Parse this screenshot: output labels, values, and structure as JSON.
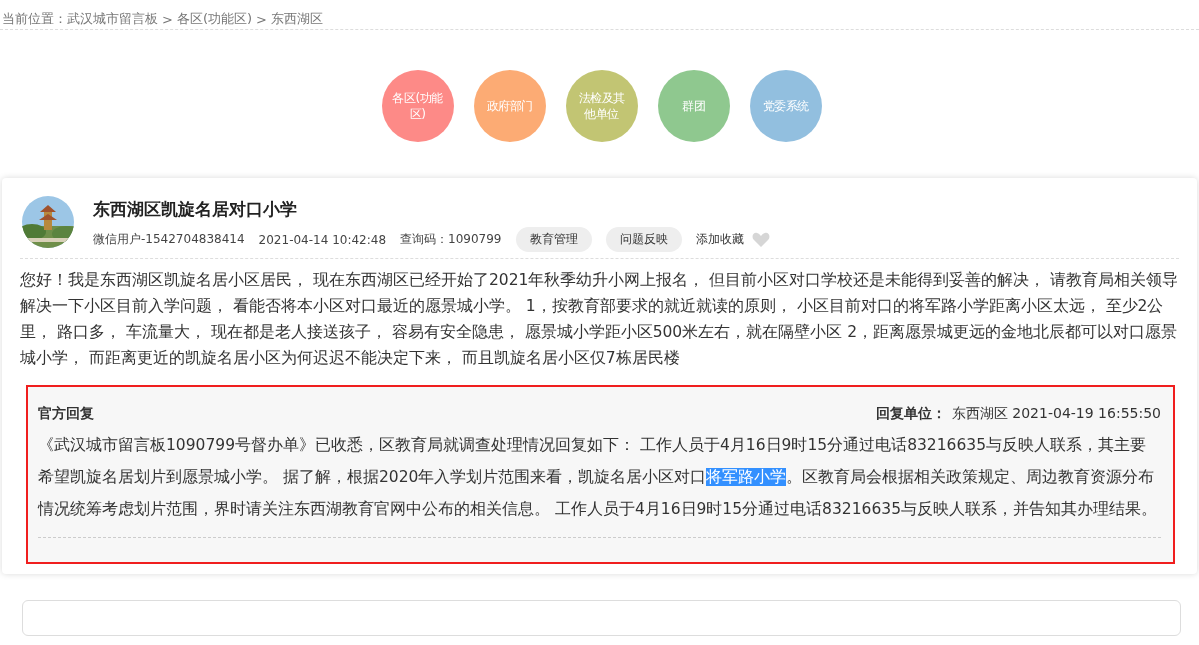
{
  "breadcrumb": {
    "label": "当前位置：",
    "items": [
      "武汉城市留言板",
      "各区(功能区)",
      "东西湖区"
    ],
    "separator": ">"
  },
  "categories": [
    {
      "label": "各区(功能区)",
      "color": "#fd8a87"
    },
    {
      "label": "政府部门",
      "color": "#fcab74"
    },
    {
      "label": "法检及其他单位",
      "color": "#c2c573"
    },
    {
      "label": "群团",
      "color": "#8fc88f"
    },
    {
      "label": "党委系统",
      "color": "#92bfdf"
    }
  ],
  "post": {
    "avatar": {
      "kind": "picture"
    },
    "title": "东西湖区凯旋名居对口小学",
    "author": "微信用户-1542704838414",
    "time": "2021-04-14 10:42:48",
    "query_code": "查询码：1090799",
    "tags": [
      "教育管理",
      "问题反映"
    ],
    "favorite": {
      "label": "添加收藏",
      "on": false
    },
    "body": "您好！我是东西湖区凯旋名居小区居民， 现在东西湖区已经开始了2021年秋季幼升小网上报名， 但目前小区对口学校还是未能得到妥善的解决， 请教育局相关领导解决一下小区目前入学问题， 看能否将本小区对口最近的愿景城小学。 1，按教育部要求的就近就读的原则， 小区目前对口的将军路小学距离小区太远， 至少2公里， 路口多， 车流量大， 现在都是老人接送孩子， 容易有安全隐患， 愿景城小学距小区500米左右，就在隔壁小区 2，距离愿景城更远的金地北辰都可以对口愿景城小学， 而距离更近的凯旋名居小区为何迟迟不能决定下来， 而且凯旋名居小区仅7栋居民楼"
  },
  "reply": {
    "title": "官方回复",
    "unit_label": "回复单位：",
    "unit": "东西湖区",
    "time": "2021-04-19 16:55:50",
    "selected": true,
    "body": [
      {
        "text": "《武汉城市留言板1090799号督办单》已收悉，区教育局就调查处理情况回复如下： 工作人员于4月16日9时15分通过电话83216635与反映人联系，其主要希望凯旋名居划片到愿景城小学。 据了解，根据2020年入学划片范围来看，凯旋名居小区对口",
        "highlighted": false
      },
      {
        "text": "将军路小学",
        "highlighted": true
      },
      {
        "text": "。区教育局会根据相关政策规定、周边教育资源分布情况统筹考虑划片范围，界时请关注东西湖教育官网中公布的相关信息。 工作人员于4月16日9时15分通过电话83216635与反映人联系，并告知其办理结果。",
        "highlighted": false
      }
    ]
  },
  "comment": {
    "kind": "field"
  }
}
